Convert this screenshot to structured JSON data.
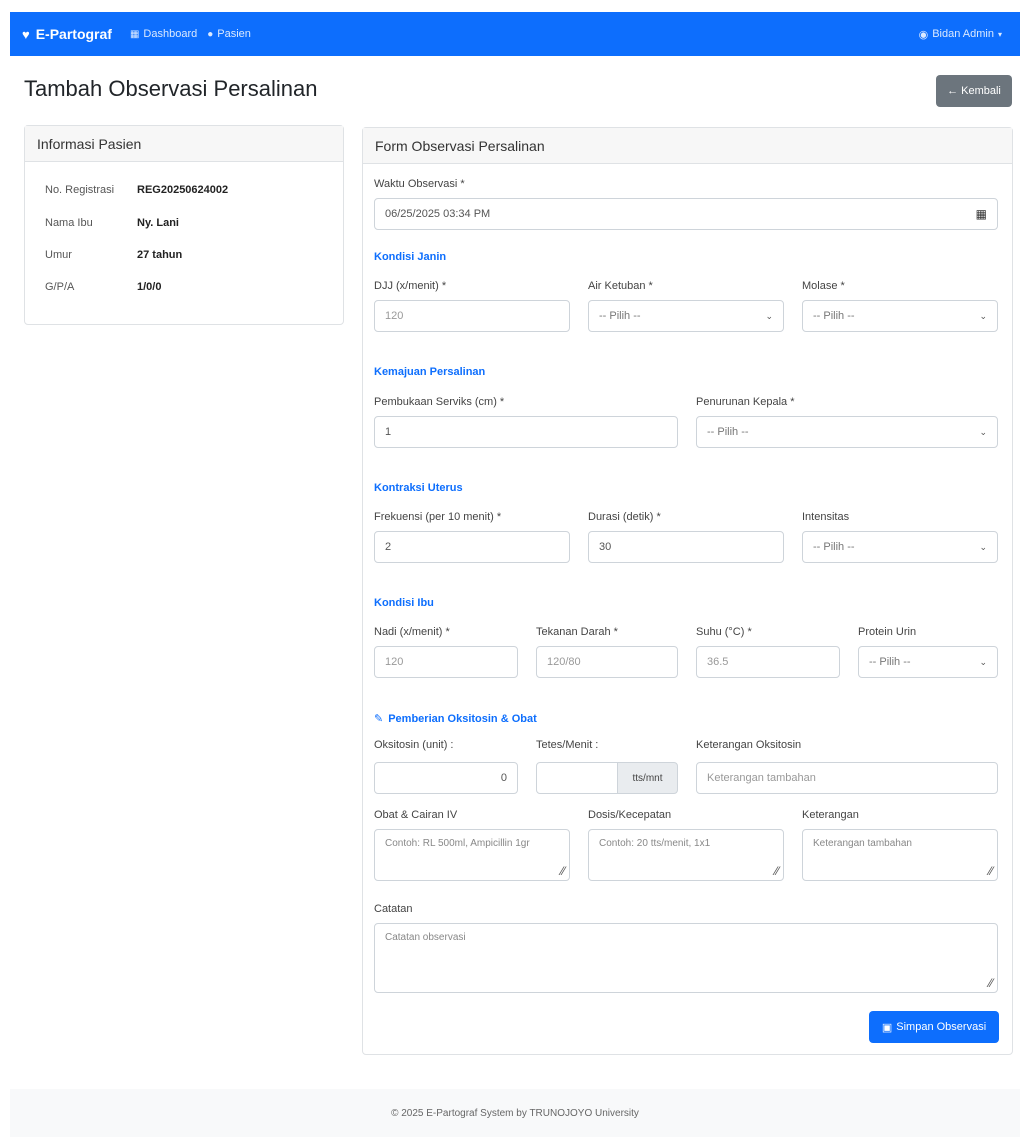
{
  "navbar": {
    "brand": "E-Partograf",
    "brand_icon": "heart-icon",
    "links": [
      {
        "label": "Dashboard",
        "icon": "grid-icon"
      },
      {
        "label": "Pasien",
        "icon": "users-icon"
      }
    ],
    "user": "Bidan Admin",
    "user_icon": "user-icon",
    "bg_color": "#0d6efd"
  },
  "header": {
    "title": "Tambah Observasi Persalinan",
    "back_label": "Kembali"
  },
  "patient": {
    "card_title": "Informasi Pasien",
    "rows": [
      {
        "label": "No. Registrasi",
        "value": "REG20250624002"
      },
      {
        "label": "Nama Ibu",
        "value": "Ny. Lani"
      },
      {
        "label": "Umur",
        "value": "27 tahun"
      },
      {
        "label": "G/P/A",
        "value": "1/0/0"
      }
    ]
  },
  "form": {
    "card_title": "Form Observasi Persalinan",
    "waktu": {
      "label": "Waktu Observasi *",
      "value": "06/25/2025 03:34 PM"
    },
    "kondisi_janin": {
      "title": "Kondisi Janin",
      "djj": {
        "label": "DJJ (x/menit) *",
        "placeholder": "120"
      },
      "air_ketuban": {
        "label": "Air Ketuban *",
        "selected": "-- Pilih --"
      },
      "molase": {
        "label": "Molase *",
        "selected": "-- Pilih --"
      }
    },
    "kemajuan": {
      "title": "Kemajuan Persalinan",
      "pembukaan": {
        "label": "Pembukaan Serviks (cm) *",
        "value": "1"
      },
      "penurunan": {
        "label": "Penurunan Kepala *",
        "selected": "-- Pilih --"
      }
    },
    "kontraksi": {
      "title": "Kontraksi Uterus",
      "frekuensi": {
        "label": "Frekuensi (per 10 menit) *",
        "value": "2"
      },
      "durasi": {
        "label": "Durasi (detik) *",
        "value": "30"
      },
      "intensitas": {
        "label": "Intensitas",
        "selected": "-- Pilih --"
      }
    },
    "kondisi_ibu": {
      "title": "Kondisi Ibu",
      "nadi": {
        "label": "Nadi (x/menit) *",
        "placeholder": "120"
      },
      "tekanan": {
        "label": "Tekanan Darah *",
        "placeholder": "120/80"
      },
      "suhu": {
        "label": "Suhu (°C) *",
        "placeholder": "36.5"
      },
      "protein": {
        "label": "Protein Urin",
        "selected": "-- Pilih --"
      }
    },
    "oksitosin": {
      "title": "Pemberian Oksitosin & Obat",
      "icon": "pencil-icon",
      "unit": {
        "label": "Oksitosin (unit) :",
        "value": "0"
      },
      "tetes": {
        "label": "Tetes/Menit :",
        "addon": "tts/mnt"
      },
      "ket_oksitosin": {
        "label": "Keterangan Oksitosin",
        "placeholder": "Keterangan tambahan"
      },
      "obat": {
        "label": "Obat & Cairan IV",
        "placeholder": "Contoh: RL 500ml, Ampicillin 1gr"
      },
      "dosis": {
        "label": "Dosis/Kecepatan",
        "placeholder": "Contoh: 20 tts/menit, 1x1"
      },
      "keterangan": {
        "label": "Keterangan",
        "placeholder": "Keterangan tambahan"
      }
    },
    "catatan": {
      "label": "Catatan",
      "placeholder": "Catatan observasi"
    },
    "submit_label": "Simpan Observasi"
  },
  "footer": {
    "text": "© 2025 E-Partograf System by TRUNOJOYO University"
  }
}
